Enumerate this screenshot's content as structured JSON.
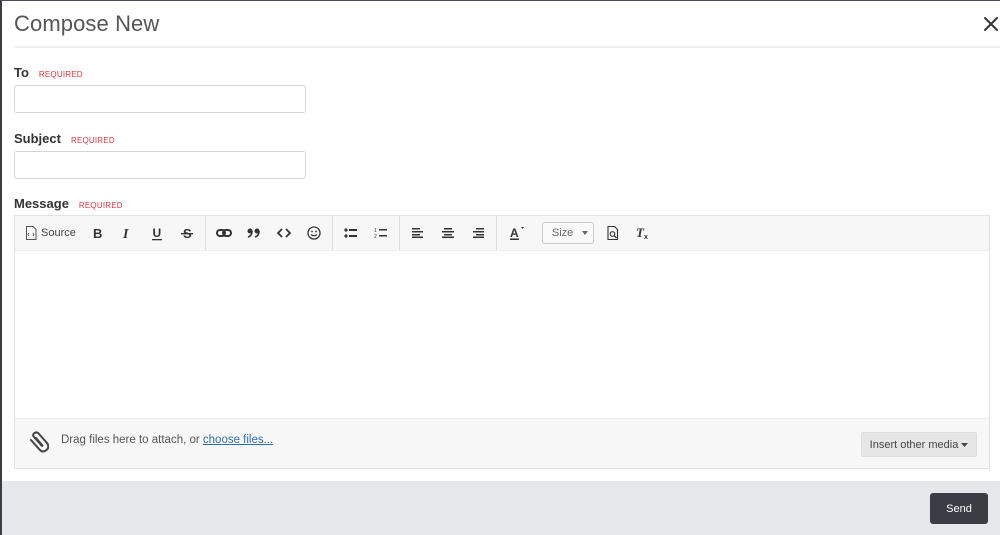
{
  "dialog": {
    "title": "Compose New",
    "close_icon": "close-icon"
  },
  "fields": {
    "to": {
      "label": "To",
      "required": "REQUIRED",
      "value": "",
      "placeholder": ""
    },
    "subject": {
      "label": "Subject",
      "required": "REQUIRED",
      "value": "",
      "placeholder": ""
    },
    "message": {
      "label": "Message",
      "required": "REQUIRED",
      "value": ""
    }
  },
  "toolbar": {
    "source_label": "Source",
    "buttons": [
      {
        "name": "bold",
        "icon": "bold-icon"
      },
      {
        "name": "italic",
        "icon": "italic-icon"
      },
      {
        "name": "underline",
        "icon": "underline-icon"
      },
      {
        "name": "strikethrough",
        "icon": "strikethrough-icon"
      },
      {
        "name": "link",
        "icon": "link-icon"
      },
      {
        "name": "blockquote",
        "icon": "quote-icon"
      },
      {
        "name": "code",
        "icon": "code-icon"
      },
      {
        "name": "emoji",
        "icon": "emoji-icon"
      },
      {
        "name": "bulleted-list",
        "icon": "bulleted-list-icon"
      },
      {
        "name": "numbered-list",
        "icon": "numbered-list-icon"
      },
      {
        "name": "align-left",
        "icon": "align-left-icon"
      },
      {
        "name": "align-center",
        "icon": "align-center-icon"
      },
      {
        "name": "align-right",
        "icon": "align-right-icon"
      },
      {
        "name": "text-color",
        "icon": "text-color-icon"
      },
      {
        "name": "preview",
        "icon": "preview-icon"
      },
      {
        "name": "remove-format",
        "icon": "remove-format-icon"
      }
    ],
    "size_label": "Size"
  },
  "attach": {
    "text": "Drag files here to attach, or ",
    "link": "choose files...",
    "media_button": "Insert other media"
  },
  "footer": {
    "send_label": "Send"
  },
  "colors": {
    "required": "#d9363e",
    "link": "#2e6fae",
    "send_bg": "#3a3d44",
    "footer_bg": "#e6e7eb"
  }
}
